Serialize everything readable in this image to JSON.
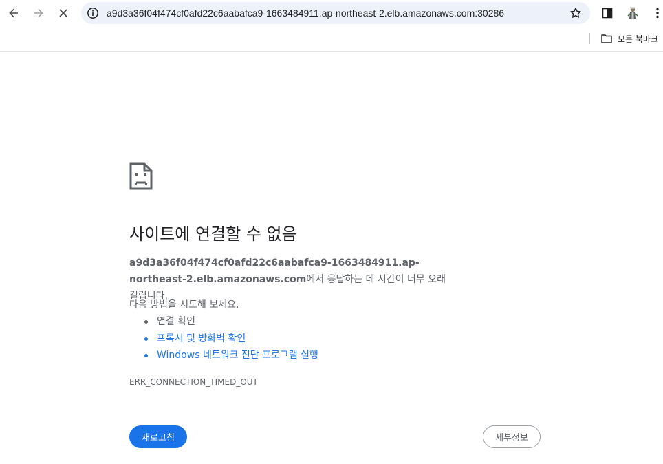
{
  "browser": {
    "url": "a9d3a36f04f474cf0afd22c6aabafca9-1663484911.ap-northeast-2.elb.amazonaws.com:30286",
    "icons": {
      "back": "arrow-left-icon",
      "forward": "arrow-right-icon",
      "stop": "close-icon",
      "site_info": "info-icon",
      "bookmark": "star-icon",
      "side_panel": "side-panel-icon",
      "profile": "avatar",
      "menu": "more-vert-icon"
    }
  },
  "bookmarks_bar": {
    "all_bookmarks_label": "모든 북마크",
    "icon": "folder-icon"
  },
  "error_page": {
    "icon": "sad-document-icon",
    "headline": "사이트에 연결할 수 없음",
    "host": "a9d3a36f04f474cf0afd22c6aabafca9-1663484911.ap-northeast-2.elb.amazonaws.com",
    "message_suffix": "에서 응답하는 데 시간이 너무 오래 걸립니다.",
    "suggestions_intro": "다음 방법을 시도해 보세요.",
    "suggestions": [
      {
        "label": "연결 확인",
        "link": false
      },
      {
        "label": "프록시 및 방화벽 확인",
        "link": true
      },
      {
        "label": "Windows 네트워크 진단 프로그램 실행",
        "link": true
      }
    ],
    "error_code": "ERR_CONNECTION_TIMED_OUT",
    "reload_label": "새로고침",
    "details_label": "세부정보"
  },
  "colors": {
    "accent": "#1a73e8",
    "text_secondary": "#5f6368",
    "omnibox_bg": "#edf2fa"
  }
}
